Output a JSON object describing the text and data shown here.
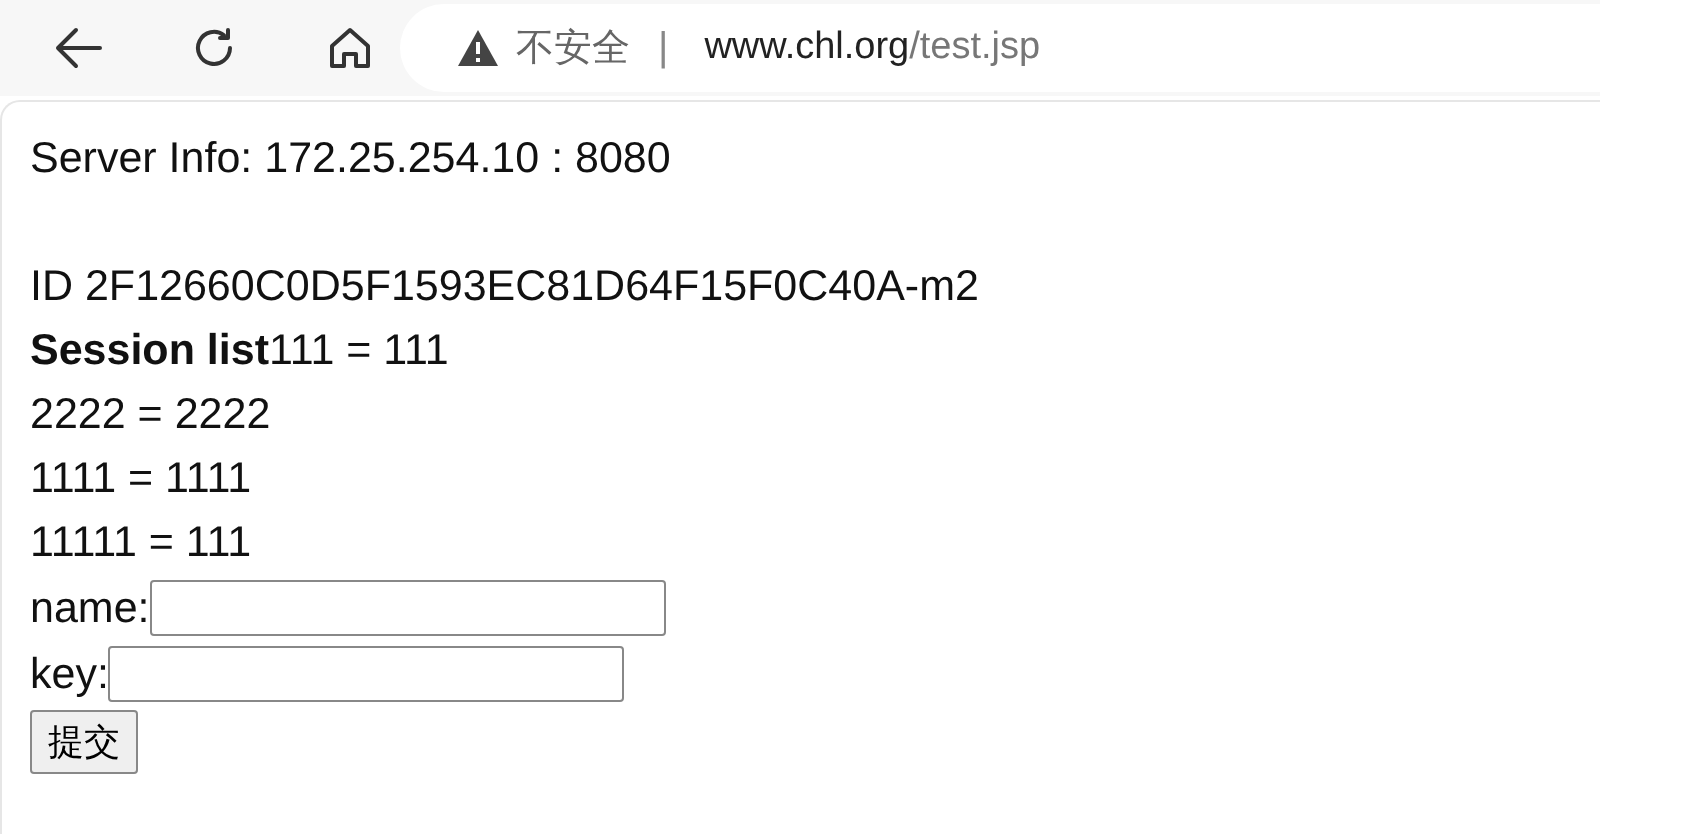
{
  "toolbar": {
    "security_label": "不安全",
    "separator": "|",
    "url": {
      "host": "www.chl.org",
      "path": "/test.jsp"
    }
  },
  "page": {
    "server_info": "Server Info: 172.25.254.10 : 8080",
    "session_id": "ID 2F12660C0D5F1593EC81D64F15F0C40A-m2",
    "session_list": {
      "title": "Session list",
      "entries": [
        "111 = 111",
        "2222 = 2222",
        "1111 = 1111",
        "11111 = 111"
      ]
    },
    "form": {
      "fields": [
        {
          "label": "name:"
        },
        {
          "label": "key:"
        }
      ],
      "submit": "提交"
    }
  }
}
